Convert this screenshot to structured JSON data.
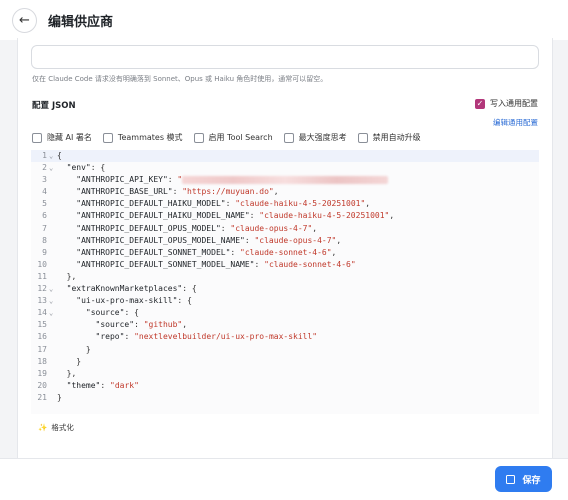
{
  "header": {
    "back_icon": "arrow-left-icon",
    "title": "编辑供应商"
  },
  "form": {
    "input_value": "",
    "hint": "仅在 Claude Code 请求没有明确落到 Sonnet、Opus 或 Haiku 角色时使用，通常可以留空。"
  },
  "config": {
    "label": "配置 JSON",
    "write_general_label": "写入通用配置",
    "write_general_checked": true,
    "edit_general_label": "编辑通用配置",
    "options": [
      {
        "label": "隐藏 AI 署名",
        "checked": false
      },
      {
        "label": "Teammates 模式",
        "checked": false
      },
      {
        "label": "启用 Tool Search",
        "checked": false
      },
      {
        "label": "最大强度思考",
        "checked": false
      },
      {
        "label": "禁用自动升级",
        "checked": false
      }
    ]
  },
  "editor": {
    "lines": [
      {
        "n": "1",
        "fold": "⌄",
        "indent": "",
        "key": "",
        "sep": "",
        "str": "",
        "tail": "{"
      },
      {
        "n": "2",
        "fold": "⌄",
        "indent": "  ",
        "key": "\"env\"",
        "sep": ": ",
        "str": "",
        "tail": "{"
      },
      {
        "n": "3",
        "fold": "",
        "indent": "    ",
        "key": "\"ANTHROPIC_API_KEY\"",
        "sep": ": ",
        "str": "\"",
        "tail": "",
        "redacted": true
      },
      {
        "n": "4",
        "fold": "",
        "indent": "    ",
        "key": "\"ANTHROPIC_BASE_URL\"",
        "sep": ": ",
        "str": "\"https://muyuan.do\"",
        "tail": ","
      },
      {
        "n": "5",
        "fold": "",
        "indent": "    ",
        "key": "\"ANTHROPIC_DEFAULT_HAIKU_MODEL\"",
        "sep": ": ",
        "str": "\"claude-haiku-4-5-20251001\"",
        "tail": ","
      },
      {
        "n": "6",
        "fold": "",
        "indent": "    ",
        "key": "\"ANTHROPIC_DEFAULT_HAIKU_MODEL_NAME\"",
        "sep": ": ",
        "str": "\"claude-haiku-4-5-20251001\"",
        "tail": ","
      },
      {
        "n": "7",
        "fold": "",
        "indent": "    ",
        "key": "\"ANTHROPIC_DEFAULT_OPUS_MODEL\"",
        "sep": ": ",
        "str": "\"claude-opus-4-7\"",
        "tail": ","
      },
      {
        "n": "8",
        "fold": "",
        "indent": "    ",
        "key": "\"ANTHROPIC_DEFAULT_OPUS_MODEL_NAME\"",
        "sep": ": ",
        "str": "\"claude-opus-4-7\"",
        "tail": ","
      },
      {
        "n": "9",
        "fold": "",
        "indent": "    ",
        "key": "\"ANTHROPIC_DEFAULT_SONNET_MODEL\"",
        "sep": ": ",
        "str": "\"claude-sonnet-4-6\"",
        "tail": ","
      },
      {
        "n": "10",
        "fold": "",
        "indent": "    ",
        "key": "\"ANTHROPIC_DEFAULT_SONNET_MODEL_NAME\"",
        "sep": ": ",
        "str": "\"claude-sonnet-4-6\"",
        "tail": ""
      },
      {
        "n": "11",
        "fold": "",
        "indent": "  ",
        "key": "",
        "sep": "",
        "str": "",
        "tail": "},"
      },
      {
        "n": "12",
        "fold": "⌄",
        "indent": "  ",
        "key": "\"extraKnownMarketplaces\"",
        "sep": ": ",
        "str": "",
        "tail": "{"
      },
      {
        "n": "13",
        "fold": "⌄",
        "indent": "    ",
        "key": "\"ui-ux-pro-max-skill\"",
        "sep": ": ",
        "str": "",
        "tail": "{"
      },
      {
        "n": "14",
        "fold": "⌄",
        "indent": "      ",
        "key": "\"source\"",
        "sep": ": ",
        "str": "",
        "tail": "{"
      },
      {
        "n": "15",
        "fold": "",
        "indent": "        ",
        "key": "\"source\"",
        "sep": ": ",
        "str": "\"github\"",
        "tail": ","
      },
      {
        "n": "16",
        "fold": "",
        "indent": "        ",
        "key": "\"repo\"",
        "sep": ": ",
        "str": "\"nextlevelbuilder/ui-ux-pro-max-skill\"",
        "tail": ""
      },
      {
        "n": "17",
        "fold": "",
        "indent": "      ",
        "key": "",
        "sep": "",
        "str": "",
        "tail": "}"
      },
      {
        "n": "18",
        "fold": "",
        "indent": "    ",
        "key": "",
        "sep": "",
        "str": "",
        "tail": "}"
      },
      {
        "n": "19",
        "fold": "",
        "indent": "  ",
        "key": "",
        "sep": "",
        "str": "",
        "tail": "},"
      },
      {
        "n": "20",
        "fold": "",
        "indent": "  ",
        "key": "\"theme\"",
        "sep": ": ",
        "str": "\"dark\"",
        "tail": ""
      },
      {
        "n": "21",
        "fold": "",
        "indent": "",
        "key": "",
        "sep": "",
        "str": "",
        "tail": "}"
      }
    ]
  },
  "format": {
    "icon": "magic-wand-icon",
    "label": "格式化"
  },
  "footer": {
    "save_icon": "save-icon",
    "save_label": "保存"
  },
  "colors": {
    "accent": "#2f7cf0",
    "checkbox_checked": "#b2377a",
    "string": "#c0392b",
    "link": "#2a6bd5"
  }
}
